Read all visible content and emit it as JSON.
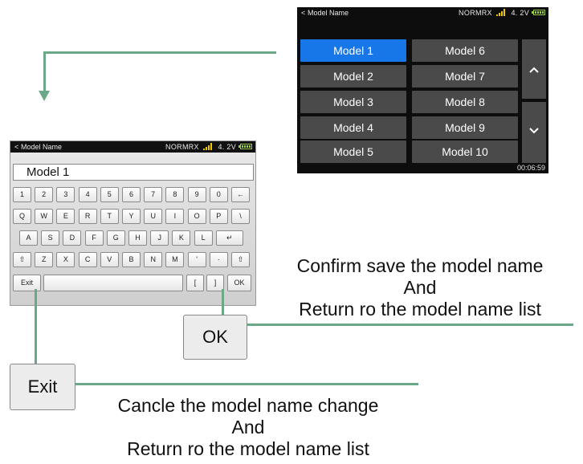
{
  "list_screen": {
    "status": {
      "back": "<",
      "title": "Model Name",
      "mode": "NORMRX",
      "voltage": "4. 2V"
    },
    "models_col1": [
      "Model 1",
      "Model 2",
      "Model 3",
      "Model 4",
      "Model 5"
    ],
    "models_col2": [
      "Model 6",
      "Model 7",
      "Model 8",
      "Model 9",
      "Model 10"
    ],
    "scroll_up": "^",
    "scroll_down": "v",
    "timer": "00:06:59",
    "selected_color": "#1776e8"
  },
  "keyboard_screen": {
    "status": {
      "back": "<",
      "title": "Model Name",
      "mode": "NORMRX",
      "voltage": "4. 2V"
    },
    "name_value": "Model  1",
    "row1": [
      "1",
      "2",
      "3",
      "4",
      "5",
      "6",
      "7",
      "8",
      "9",
      "0",
      "←"
    ],
    "row2": [
      "Q",
      "W",
      "E",
      "R",
      "T",
      "Y",
      "U",
      "I",
      "O",
      "P",
      "\\"
    ],
    "row3": [
      "A",
      "S",
      "D",
      "F",
      "G",
      "H",
      "J",
      "K",
      "L",
      "↵"
    ],
    "row4": [
      "⇧",
      "Z",
      "X",
      "C",
      "V",
      "B",
      "N",
      "M",
      "'",
      "·",
      "⇧"
    ],
    "exit_key": "Exit",
    "bracket_open": "[",
    "bracket_close": "]",
    "ok_key": "OK"
  },
  "callouts": {
    "ok_box": "OK",
    "exit_box": "Exit",
    "ok_caption": [
      "Confirm save the model name",
      "And",
      "Return ro the model name list"
    ],
    "exit_caption": [
      "Cancle the model name change",
      "And",
      "Return ro the model name list"
    ],
    "line_color": "#6aa887"
  }
}
